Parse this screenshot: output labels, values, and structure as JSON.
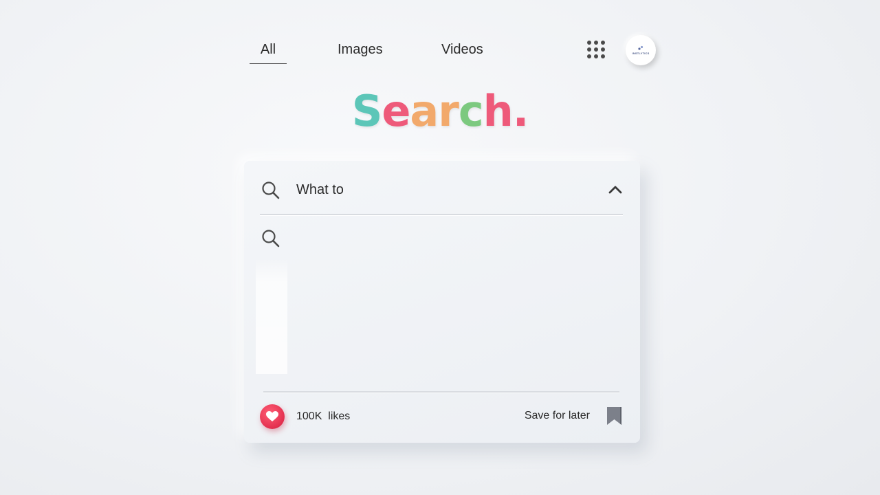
{
  "nav": {
    "tabs": [
      {
        "label": "All",
        "active": true
      },
      {
        "label": "Images",
        "active": false
      },
      {
        "label": "Videos",
        "active": false
      }
    ],
    "apps_icon": "apps-grid-icon",
    "avatar": {
      "text": "INSTLYTICS"
    }
  },
  "logo": {
    "letters": [
      {
        "char": "S",
        "color": "#5cc6b8"
      },
      {
        "char": "e",
        "color": "#ee5a7a"
      },
      {
        "char": "a",
        "color": "#f2a96b"
      },
      {
        "char": "r",
        "color": "#f2a96b"
      },
      {
        "char": "c",
        "color": "#7cc97f"
      },
      {
        "char": "h",
        "color": "#ee5a7a"
      },
      {
        "char": ".",
        "color": "#ee5a7a"
      }
    ]
  },
  "search": {
    "query": "What to",
    "icon": "search-icon",
    "collapse_icon": "chevron-up-icon",
    "suggestions": [
      {
        "icon": "search-icon",
        "text": ""
      }
    ]
  },
  "footer": {
    "likes": "100K  likes",
    "like_icon": "heart-icon",
    "save_label": "Save for later",
    "save_icon": "bookmark-icon"
  },
  "colors": {
    "heart": "#e3304f",
    "bookmark": "#7c808a",
    "text": "#2a2a2a"
  }
}
